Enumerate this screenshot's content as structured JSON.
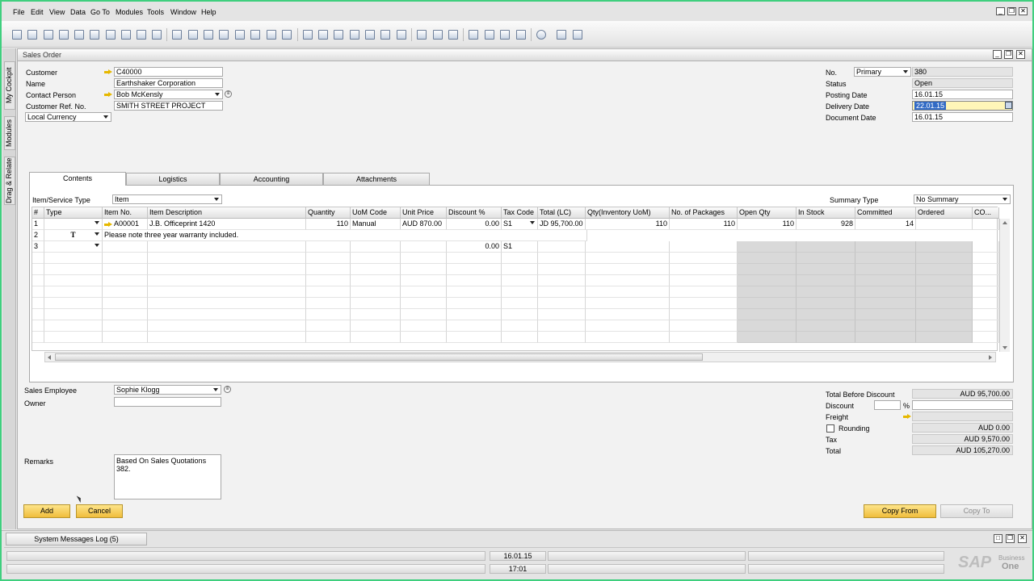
{
  "menu": [
    "File",
    "Edit",
    "View",
    "Data",
    "Go To",
    "Modules",
    "Tools",
    "Window",
    "Help"
  ],
  "side_tabs": [
    "My Cockpit",
    "Modules",
    "Drag & Relate"
  ],
  "form_title": "Sales Order",
  "header_left": {
    "customer_label": "Customer",
    "customer_value": "C40000",
    "name_label": "Name",
    "name_value": "Earthshaker Corporation",
    "contact_label": "Contact Person",
    "contact_value": "Bob McKensly",
    "custref_label": "Customer Ref. No.",
    "custref_value": "SMITH STREET PROJECT",
    "currency_value": "Local Currency"
  },
  "header_right": {
    "no_label": "No.",
    "series_value": "Primary",
    "no_value": "380",
    "status_label": "Status",
    "status_value": "Open",
    "posting_label": "Posting Date",
    "posting_value": "16.01.15",
    "delivery_label": "Delivery Date",
    "delivery_value": "22.01.15",
    "document_label": "Document Date",
    "document_value": "16.01.15"
  },
  "tabs": [
    "Contents",
    "Logistics",
    "Accounting",
    "Attachments"
  ],
  "contents": {
    "item_service_type_label": "Item/Service Type",
    "item_service_type_value": "Item",
    "summary_type_label": "Summary Type",
    "summary_type_value": "No Summary"
  },
  "grid": {
    "columns": [
      "#",
      "Type",
      "Item No.",
      "Item Description",
      "Quantity",
      "UoM Code",
      "Unit Price",
      "Discount %",
      "Tax Code",
      "Total (LC)",
      "Qty(Inventory UoM)",
      "No. of Packages",
      "Open Qty",
      "In Stock",
      "Committed",
      "Ordered",
      "CO..."
    ],
    "row1": {
      "num": "1",
      "item_no": "A00001",
      "desc": "J.B. Officeprint 1420",
      "qty": "110",
      "uom": "Manual",
      "price": "AUD 870.00",
      "disc": "0.00",
      "tax": "S1",
      "total": "JD 95,700.00",
      "qty_inv": "110",
      "packages": "110",
      "open_qty": "110",
      "in_stock": "928",
      "committed": "14"
    },
    "row2": {
      "num": "2",
      "type_glyph": "T",
      "desc": "Please note three year warranty included."
    },
    "row3": {
      "num": "3",
      "disc": "0.00",
      "tax": "S1"
    }
  },
  "footer_left": {
    "sales_employee_label": "Sales Employee",
    "sales_employee_value": "Sophie Klogg",
    "owner_label": "Owner",
    "owner_value": "",
    "remarks_label": "Remarks",
    "remarks_value": "Based On Sales Quotations 382."
  },
  "totals": {
    "before_discount_label": "Total Before Discount",
    "before_discount_value": "AUD 95,700.00",
    "discount_label": "Discount",
    "discount_pct": "",
    "pct_sign": "%",
    "discount_value": "",
    "freight_label": "Freight",
    "freight_value": "",
    "rounding_label": "Rounding",
    "rounding_value": "AUD 0.00",
    "tax_label": "Tax",
    "tax_value": "AUD 9,570.00",
    "total_label": "Total",
    "total_value": "AUD 105,270.00"
  },
  "buttons": {
    "add": "Add",
    "cancel": "Cancel",
    "copy_from": "Copy From",
    "copy_to": "Copy To"
  },
  "status": {
    "messages_tab": "System Messages Log (5)",
    "date": "16.01.15",
    "time": "17:01",
    "brand": "SAP",
    "brand_sub1": "Business",
    "brand_sub2": "One"
  },
  "colors": {
    "accent": "#f0bd3c",
    "frame": "#3fcf7e",
    "highlight": "#316ac5"
  }
}
